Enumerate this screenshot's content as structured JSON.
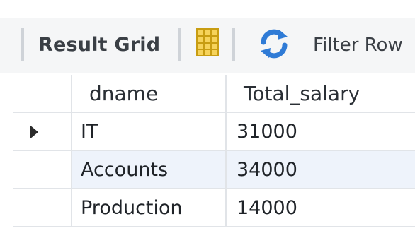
{
  "toolbar": {
    "result_grid_label": "Result Grid",
    "filter_rows_label": "Filter Row"
  },
  "icons": {
    "grid_toggle": "grid-layout-icon",
    "refresh": "refresh-icon",
    "row_pointer": "row-pointer-icon"
  },
  "colors": {
    "toolbar_bg": "#f5f6f7",
    "selected_row_bg": "#eef3fb",
    "grid_line": "#e1e4e8",
    "refresh_blue": "#2f7bd6",
    "grid_icon_yellow": "#f0c419"
  },
  "table": {
    "columns": [
      "dname",
      "Total_salary"
    ],
    "rows": [
      {
        "dname": "IT",
        "Total_salary": "31000"
      },
      {
        "dname": "Accounts",
        "Total_salary": "34000"
      },
      {
        "dname": "Production",
        "Total_salary": "14000"
      }
    ]
  }
}
